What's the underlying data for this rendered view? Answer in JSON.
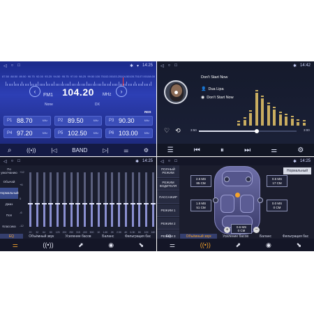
{
  "radio": {
    "status_time": "14:25",
    "scale_labels": [
      "87.50",
      "88.50",
      "89.50",
      "90.75",
      "92.00",
      "93.25",
      "94.50",
      "95.75",
      "97.00",
      "98.25",
      "99.50",
      "100.75",
      "102.00",
      "103.25",
      "104.50",
      "105.75",
      "107.00",
      "108.00"
    ],
    "band_name": "FM1",
    "frequency": "104.20",
    "unit": "MHz",
    "pty": "None",
    "dx": "DX",
    "rds": "RDS",
    "presets": [
      {
        "num": "P1",
        "value": "88.70",
        "unit": "MHz"
      },
      {
        "num": "P2",
        "value": "89.50",
        "unit": "MHz"
      },
      {
        "num": "P3",
        "value": "90.30",
        "unit": "MHz"
      },
      {
        "num": "P4",
        "value": "97.20",
        "unit": "MHz"
      },
      {
        "num": "P5",
        "value": "102.50",
        "unit": "MHz"
      },
      {
        "num": "P6",
        "value": "103.00",
        "unit": "MHz"
      }
    ],
    "band_label": "BAND",
    "needle_fraction": 0.81
  },
  "music": {
    "status_time": "14:42",
    "title": "Don't Start Now",
    "artist": "Dua Lipa",
    "album": "Don't Start Now",
    "time_current": "3:50",
    "time_total": "3:00",
    "progress_fraction": 0.59,
    "spectrum_levels": [
      0.05,
      0.15,
      0.35,
      0.9,
      0.75,
      0.55,
      0.45,
      0.3,
      0.25,
      0.2,
      0.1,
      0.08
    ]
  },
  "eq": {
    "status_time": "14:25",
    "modes": [
      "По умолчанию",
      "Обычай",
      "Нормальный",
      "Джаз",
      "Поп",
      "Классика",
      "Рок"
    ],
    "selected_mode": "Нормальный",
    "scale": [
      "+12",
      "+6",
      "0",
      "-6",
      "-12"
    ],
    "band_labels": [
      "20",
      "32",
      "64",
      "80",
      "125",
      "200",
      "250",
      "315",
      "400",
      "500",
      "1K",
      "1.6K",
      "2K",
      "2.5K",
      "4K",
      "6.3K",
      "8K",
      "10K",
      "16K"
    ],
    "band_levels": [
      0.42,
      0.42,
      0.42,
      0.42,
      0.42,
      0.42,
      0.42,
      0.42,
      0.42,
      0.42,
      0.42,
      0.42,
      0.42,
      0.42,
      0.42,
      0.42,
      0.42,
      0.42,
      0.42
    ],
    "tabs": [
      "EQ",
      "Объёмный звук",
      "Усиление басов",
      "Баланс",
      "Фильтрация бас"
    ],
    "active_tab": "EQ"
  },
  "balance": {
    "status_time": "14:25",
    "modes": [
      "ПОЛНЫЙ РЕЖИМ",
      "РЕЖИМ ВОДИТЕЛЯ",
      "ПАССАЖИР",
      "РЕЖИМ 1",
      "РЕЖИМ 2",
      "РЕЖИМ 3"
    ],
    "preset_button": "Нормальный",
    "boxes": [
      {
        "line1": "2.5 MS",
        "line2": "85 CM"
      },
      {
        "line1": "0.5 MS",
        "line2": "17 CM"
      },
      {
        "line1": "1.5 MS",
        "line2": "51 CM"
      },
      {
        "line1": "0.0 MS",
        "line2": "0 CM"
      },
      {
        "line1": "0.6 MS",
        "line2": "0 CM"
      }
    ],
    "tabs": [
      "EQ",
      "Объёмный звук",
      "Усиление басов",
      "Баланс",
      "Фильтрация бас"
    ],
    "active_tab": "Объёмный звук"
  }
}
